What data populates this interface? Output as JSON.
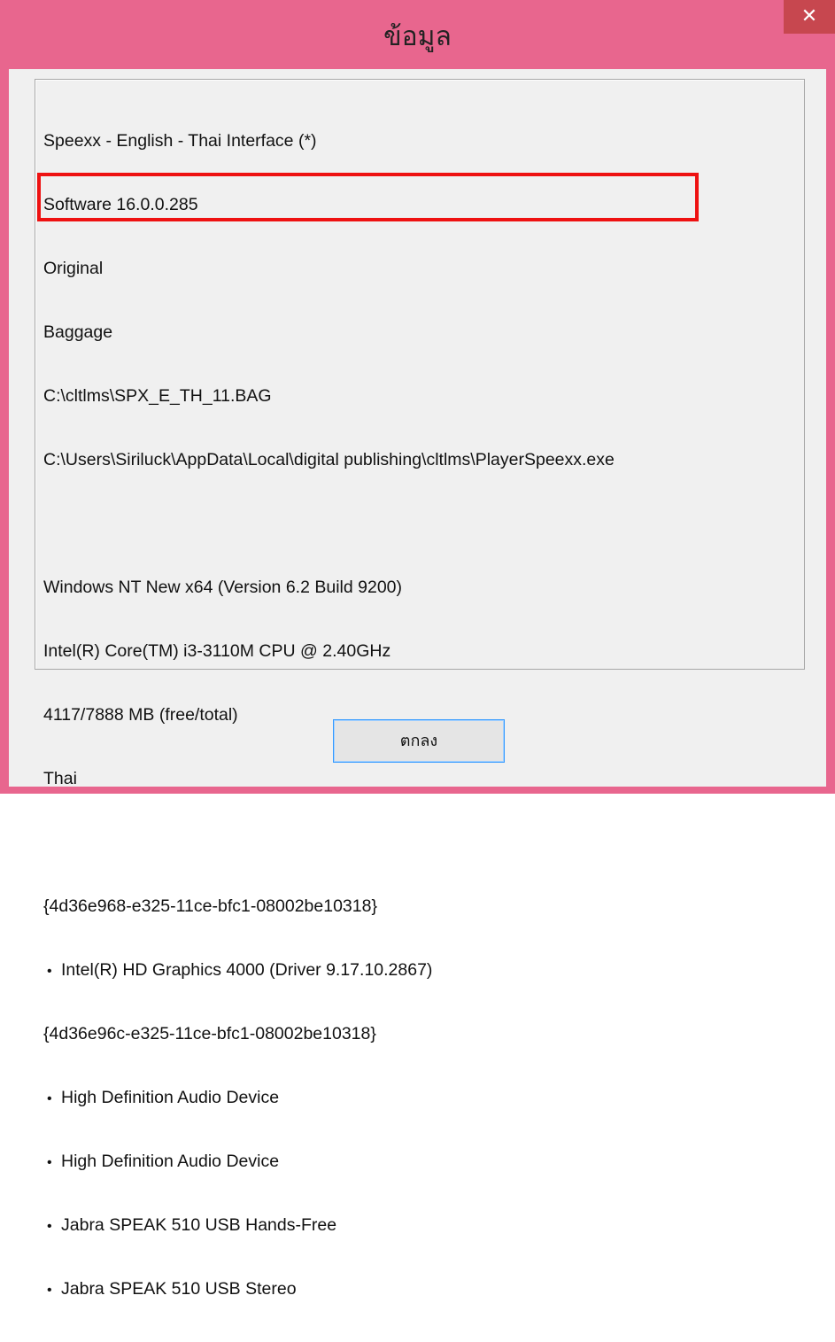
{
  "window": {
    "title": "ข้อมูล",
    "close_glyph": "✕",
    "frame_color": "#e8668e",
    "close_color": "#c7474f"
  },
  "info": {
    "product": "Speexx - English - Thai Interface (*)",
    "software": "Software 16.0.0.285",
    "edition": "Original",
    "baggage_label": "Baggage",
    "baggage_path": "C:\\cltlms\\SPX_E_TH_11.BAG",
    "player_path": "C:\\Users\\Siriluck\\AppData\\Local\\digital publishing\\cltlms\\PlayerSpeexx.exe",
    "os": "Windows NT New x64 (Version 6.2 Build 9200)",
    "cpu": "Intel(R) Core(TM) i3-3110M CPU @ 2.40GHz",
    "memory": "4117/7888 MB (free/total)",
    "language": "Thai",
    "display_class_guid": "{4d36e968-e325-11ce-bfc1-08002be10318}",
    "display_devices": [
      "Intel(R) HD Graphics 4000 (Driver 9.17.10.2867)"
    ],
    "media_class_guid": "{4d36e96c-e325-11ce-bfc1-08002be10318}",
    "media_devices": [
      "High Definition Audio Device",
      "High Definition Audio Device",
      "Jabra SPEAK 510 USB Hands-Free",
      "Jabra SPEAK 510 USB Stereo"
    ],
    "highlight_color": "#ee1111"
  },
  "footer": {
    "ok_label": "ตกลง"
  }
}
